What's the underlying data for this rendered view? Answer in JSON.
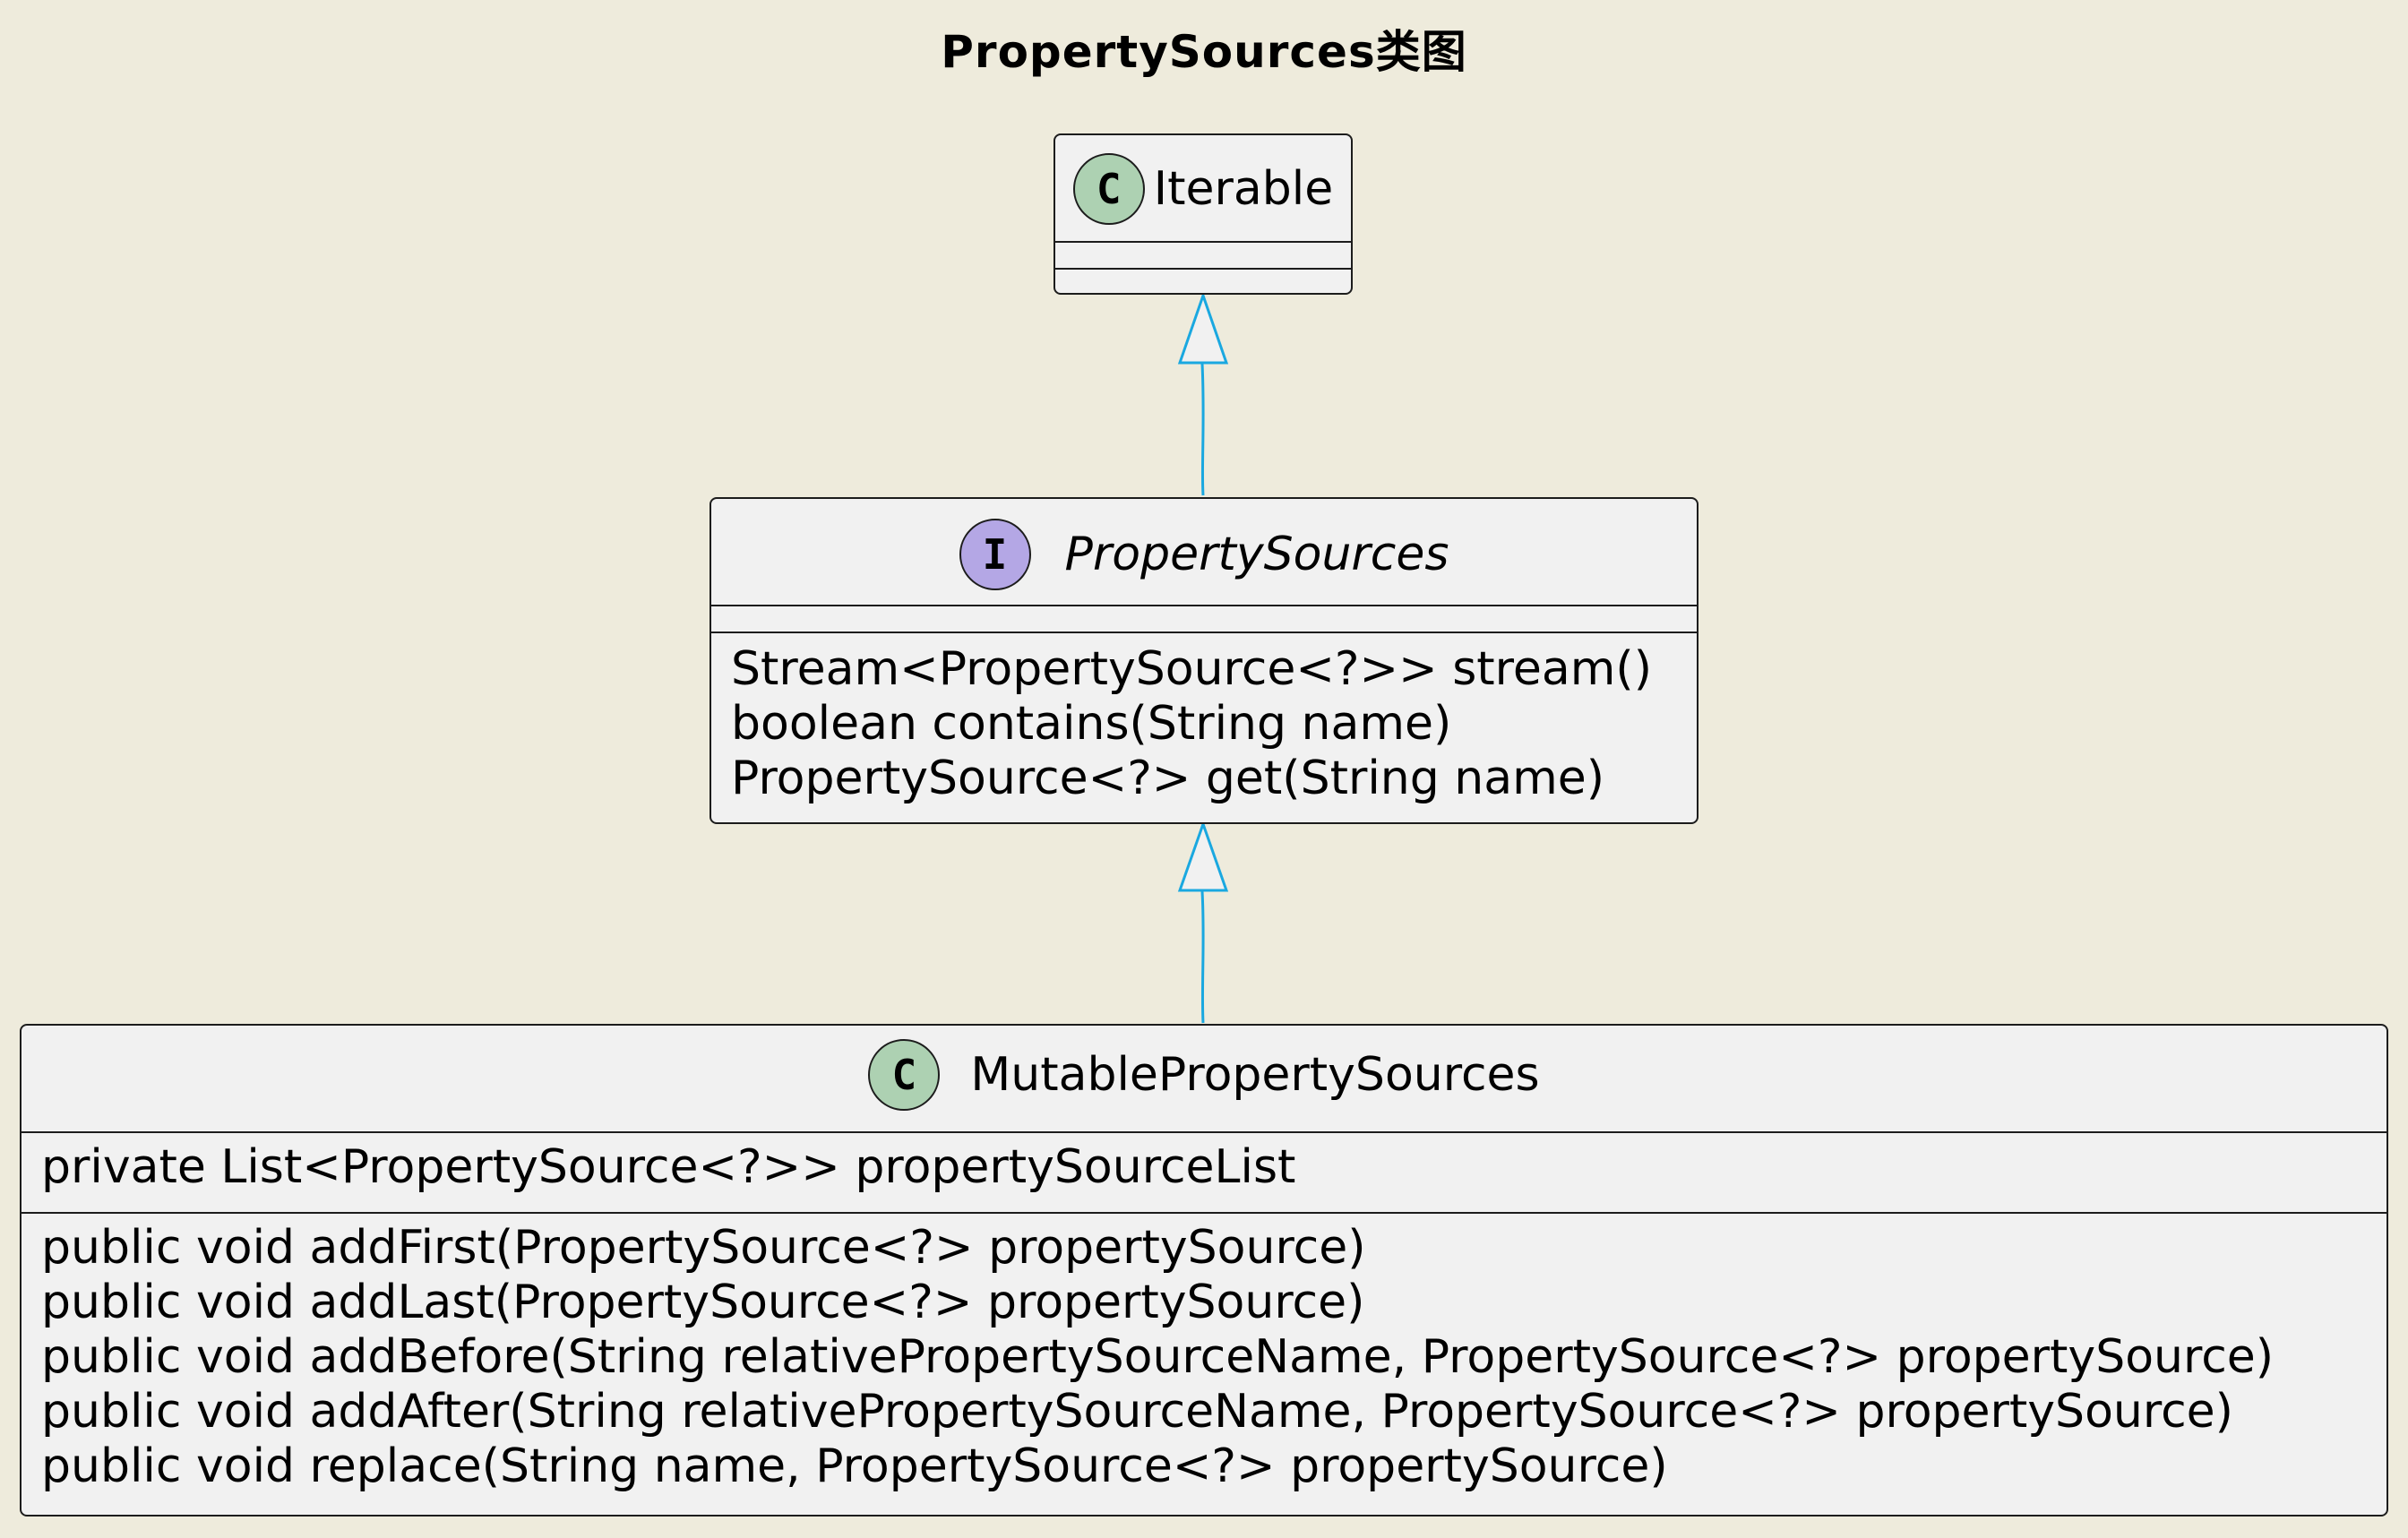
{
  "diagram": {
    "title": "PropertySources类图",
    "classes": [
      {
        "id": "iterable",
        "stereotype": "C",
        "name": "Iterable",
        "abstract": false,
        "fields": [],
        "methods": []
      },
      {
        "id": "property-sources",
        "stereotype": "I",
        "name": "PropertySources",
        "abstract": true,
        "fields": [],
        "methods": [
          "Stream<PropertySource<?>> stream()",
          "boolean contains(String name)",
          "PropertySource<?> get(String name)"
        ]
      },
      {
        "id": "mutable-property-sources",
        "stereotype": "C",
        "name": "MutablePropertySources",
        "abstract": false,
        "fields": [
          "private List<PropertySource<?>> propertySourceList"
        ],
        "methods": [
          "public void addFirst(PropertySource<?> propertySource)",
          "public void addLast(PropertySource<?> propertySource)",
          "public void addBefore(String relativePropertySourceName, PropertySource<?> propertySource)",
          "public void addAfter(String relativePropertySourceName, PropertySource<?> propertySource)",
          "public void replace(String name, PropertySource<?> propertySource)"
        ]
      }
    ],
    "relations": [
      {
        "from": "property-sources",
        "to": "iterable",
        "type": "generalization"
      },
      {
        "from": "mutable-property-sources",
        "to": "property-sources",
        "type": "generalization"
      }
    ],
    "colors": {
      "background": "#eeebdc",
      "box_fill": "#f1f1f1",
      "class_stereotype": "#add1b2",
      "interface_stereotype": "#b4a7e5",
      "arrow": "#1aa8e0"
    }
  }
}
